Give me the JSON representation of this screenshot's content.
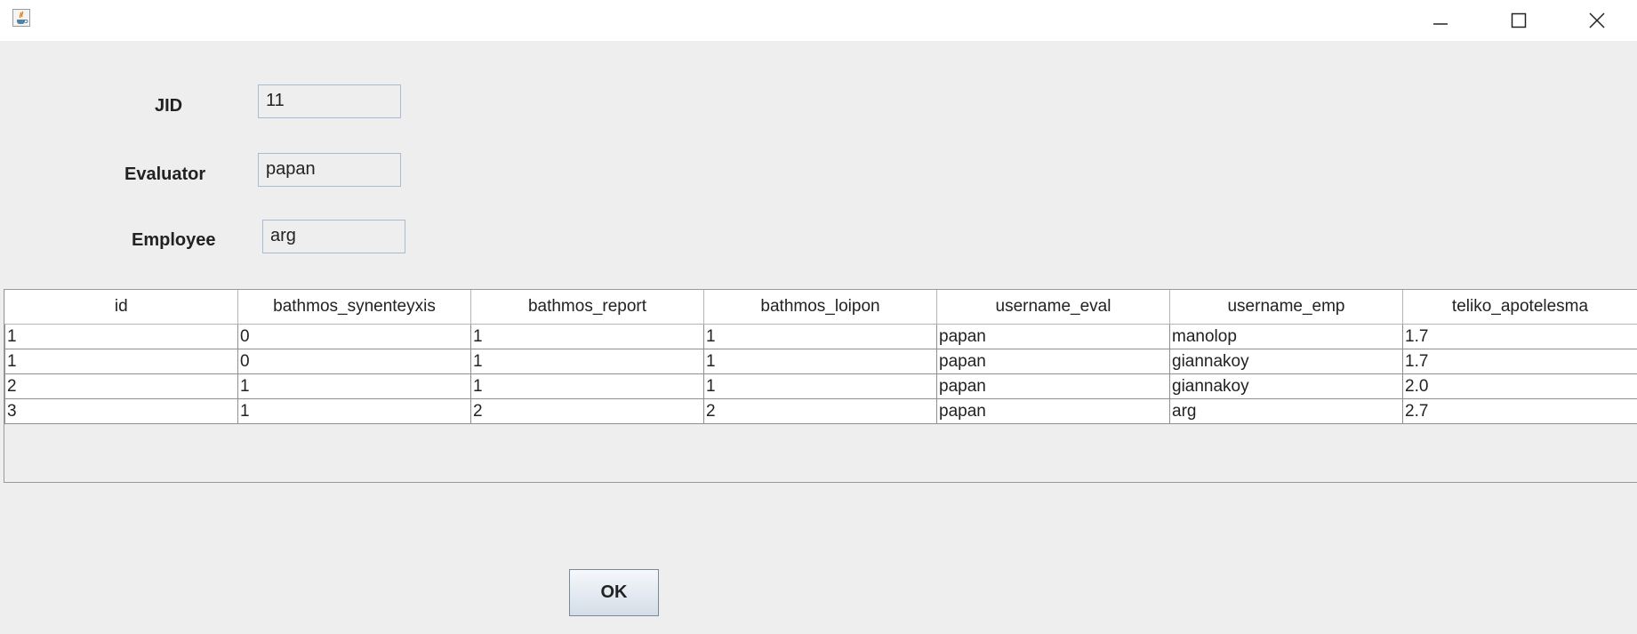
{
  "window": {
    "app_icon": "java-cup-icon",
    "controls": [
      "minimize-icon",
      "maximize-icon",
      "close-icon"
    ]
  },
  "form": {
    "jid_label": "JID",
    "jid_value": "11",
    "evaluator_label": "Evaluator",
    "evaluator_value": "papan",
    "employee_label": "Employee",
    "employee_value": "arg"
  },
  "table": {
    "columns": [
      "id",
      "bathmos_synenteyxis",
      "bathmos_report",
      "bathmos_loipon",
      "username_eval",
      "username_emp",
      "teliko_apotelesma"
    ],
    "rows": [
      [
        "1",
        "0",
        "1",
        "1",
        "papan",
        "manolop",
        "1.7"
      ],
      [
        "1",
        "0",
        "1",
        "1",
        "papan",
        "giannakoy",
        "1.7"
      ],
      [
        "2",
        "1",
        "1",
        "1",
        "papan",
        "giannakoy",
        "2.0"
      ],
      [
        "3",
        "1",
        "2",
        "2",
        "papan",
        "arg",
        "2.7"
      ]
    ]
  },
  "ok_label": "OK"
}
